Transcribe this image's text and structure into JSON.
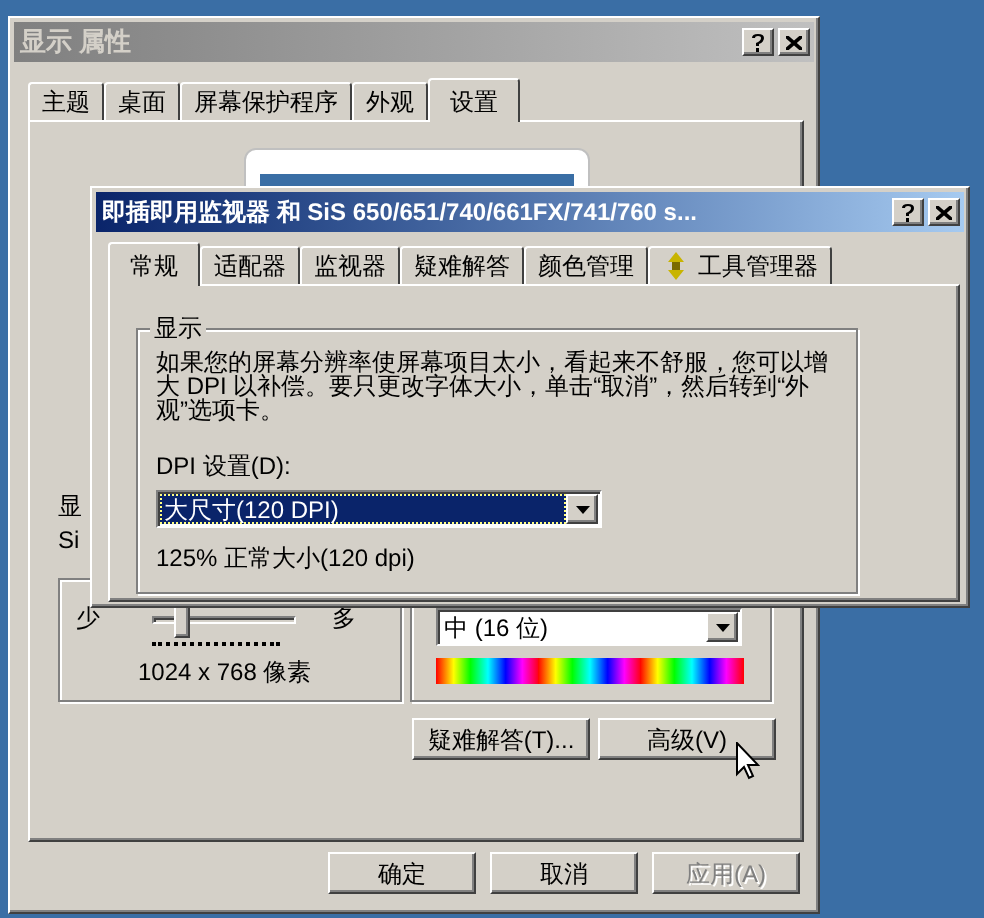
{
  "display_properties": {
    "title": "显示 属性",
    "tabs": [
      {
        "label": "主题",
        "selected": false
      },
      {
        "label": "桌面",
        "selected": false
      },
      {
        "label": "屏幕保护程序",
        "selected": false
      },
      {
        "label": "外观",
        "selected": false
      },
      {
        "label": "设置",
        "selected": true
      }
    ],
    "partial_labels": [
      "显",
      "Si"
    ],
    "resolution": {
      "min_label": "少",
      "max_label": "多",
      "level": 0.15,
      "value": "1024 x 768 像素"
    },
    "color_quality": {
      "value": "中 (16 位)"
    },
    "buttons": [
      {
        "label": "疑难解答(T)...",
        "disabled": false
      },
      {
        "label": "高级(V)",
        "disabled": false
      }
    ],
    "footer_buttons": [
      {
        "label": "确定",
        "disabled": false
      },
      {
        "label": "取消",
        "disabled": false
      },
      {
        "label": "应用(A)",
        "disabled": true
      }
    ]
  },
  "monitor_properties": {
    "title": "即插即用监视器 和 SiS 650/651/740/661FX/741/760 s...",
    "tabs": [
      {
        "label": "常规",
        "selected": true,
        "has_icon": false
      },
      {
        "label": "适配器",
        "selected": false,
        "has_icon": false
      },
      {
        "label": "监视器",
        "selected": false,
        "has_icon": false
      },
      {
        "label": "疑难解答",
        "selected": false,
        "has_icon": false
      },
      {
        "label": "颜色管理",
        "selected": false,
        "has_icon": false
      },
      {
        "label": "工具管理器",
        "selected": false,
        "has_icon": true
      }
    ],
    "group": {
      "title": "显示",
      "description": "如果您的屏幕分辨率使屏幕项目太小，看起来不舒服，您可以增大 DPI 以补偿。要只更改字体大小，单击“取消”，然后转到“外观”选项卡。",
      "dpi_label": "DPI 设置(D):",
      "dpi_value": "大尺寸(120 DPI)",
      "dpi_note": "125% 正常大小(120 dpi)"
    }
  }
}
